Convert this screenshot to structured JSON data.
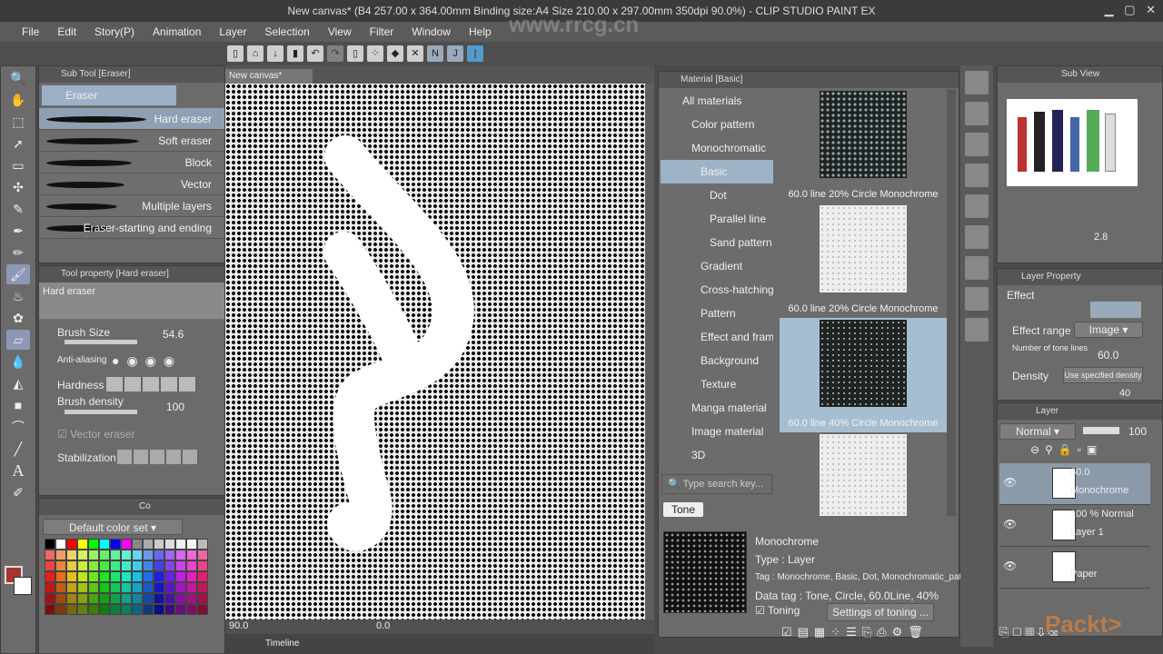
{
  "window": {
    "title": "New canvas* (B4 257.00 x 364.00mm Binding size:A4 Size 210.00 x 297.00mm 350dpi 90.0%) - CLIP STUDIO PAINT EX"
  },
  "menu": [
    "File",
    "Edit",
    "Story(P)",
    "Animation",
    "Layer",
    "Selection",
    "View",
    "Filter",
    "Window",
    "Help"
  ],
  "watermark": "www.rrcg.cn",
  "subtool": {
    "tab": "Sub Tool [Eraser]",
    "group": "Eraser",
    "items": [
      "Hard eraser",
      "Soft eraser",
      "Block",
      "Vector",
      "Multiple layers",
      "Eraser-starting and ending"
    ],
    "selected": "Hard eraser"
  },
  "toolprop": {
    "tab": "Tool property [Hard eraser]",
    "preset": "Hard eraser",
    "brush_size_label": "Brush Size",
    "brush_size": "54.6",
    "antialias_label": "Anti-aliasing",
    "hardness_label": "Hardness",
    "density_label": "Brush density",
    "density": "100",
    "vector_label": "Vector eraser",
    "stab_label": "Stabilization"
  },
  "color": {
    "tab": "Co",
    "set": "Default color set"
  },
  "canvas": {
    "tab": "New canvas*",
    "zoom": "90.0",
    "angle": "0.0",
    "timeline": "Timeline"
  },
  "material": {
    "tab": "Material [Basic]",
    "tree": [
      {
        "label": "All materials",
        "indent": 0
      },
      {
        "label": "Color pattern",
        "indent": 1
      },
      {
        "label": "Monochromatic",
        "indent": 1
      },
      {
        "label": "Basic",
        "indent": 2,
        "selected": true
      },
      {
        "label": "Dot",
        "indent": 3
      },
      {
        "label": "Parallel line",
        "indent": 3
      },
      {
        "label": "Sand pattern",
        "indent": 3
      },
      {
        "label": "Gradient",
        "indent": 2
      },
      {
        "label": "Cross-hatching",
        "indent": 2
      },
      {
        "label": "Pattern",
        "indent": 2
      },
      {
        "label": "Effect and frame",
        "indent": 2
      },
      {
        "label": "Background",
        "indent": 2
      },
      {
        "label": "Texture",
        "indent": 2
      },
      {
        "label": "Manga material",
        "indent": 1
      },
      {
        "label": "Image material",
        "indent": 1
      },
      {
        "label": "3D",
        "indent": 1
      }
    ],
    "items": [
      {
        "caption": "60.0 line 20% Circle Monochrome",
        "density": 0.6
      },
      {
        "caption": "60.0 line 20% Circle Monochrome",
        "density": 0.2
      },
      {
        "caption": "60.0 line 40% Circle Monochrome",
        "density": 0.4,
        "selected": true
      },
      {
        "caption": "",
        "density": 0.2
      }
    ],
    "search_placeholder": "Type search key...",
    "tag": "Tone",
    "detail": {
      "name": "Monochrome",
      "type": "Type : Layer",
      "tag": "Tag : Monochrome, Basic, Dot, Monochromatic_pattern",
      "data_tag": "Data tag : Tone, Circle, 60.0Line, 40%",
      "toning": "Toning",
      "toning_checked": true,
      "settings": "Settings of toning ..."
    }
  },
  "subview": {
    "tab": "Sub View",
    "zoom": "2.8"
  },
  "layerprop": {
    "tab": "Layer Property",
    "effect": "Effect",
    "range_label": "Effect range",
    "range": "Image",
    "lines_label": "Number of tone lines",
    "lines": "60.0",
    "density_label": "Density",
    "density_mode": "Use specified density",
    "density": "40"
  },
  "layers": {
    "tab": "Layer",
    "blend": "Normal",
    "opacity": "100",
    "rows": [
      {
        "line1": "60.0",
        "line2": "Monochrome",
        "selected": true
      },
      {
        "line1": "100 %  Normal",
        "line2": "Layer 1"
      },
      {
        "line1": "",
        "line2": "Paper"
      }
    ]
  },
  "brand": "Packt>"
}
